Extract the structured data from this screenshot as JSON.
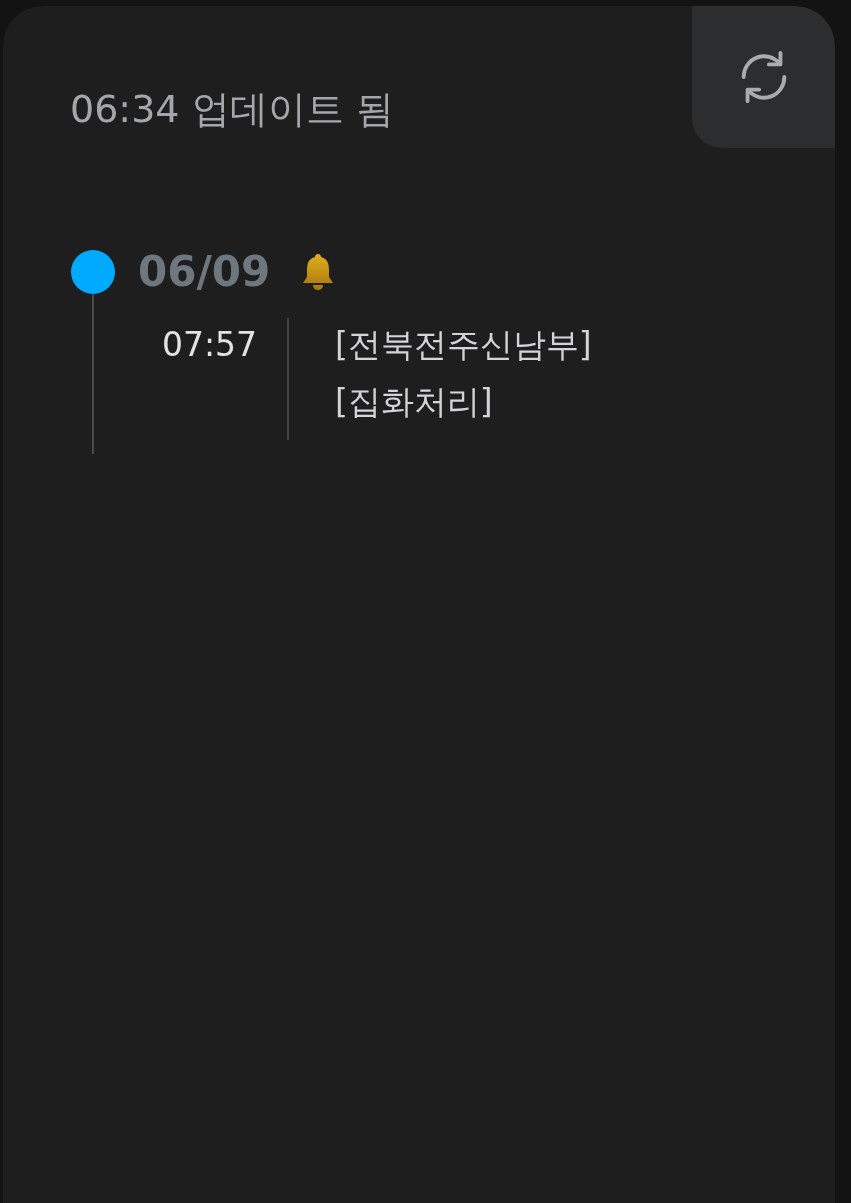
{
  "header": {
    "updated": "06:34 업데이트 됨"
  },
  "timeline": [
    {
      "date": "06/09",
      "alert": true,
      "events": [
        {
          "time": "07:57",
          "lines": [
            "[전북전주신남부]",
            "[집화처리]"
          ]
        }
      ]
    }
  ]
}
